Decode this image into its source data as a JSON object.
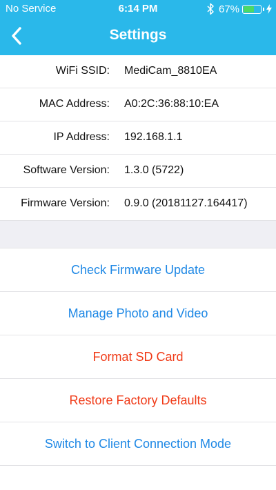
{
  "status_bar": {
    "carrier": "No Service",
    "time": "6:14 PM",
    "battery_percent": "67%",
    "battery_level": 0.67,
    "bluetooth_icon": "bluetooth-icon",
    "charging_icon": "charging-bolt-icon"
  },
  "nav": {
    "title": "Settings",
    "back_icon": "chevron-left-icon"
  },
  "info": [
    {
      "label": "WiFi SSID:",
      "value": "MediCam_8810EA"
    },
    {
      "label": "MAC Address:",
      "value": "A0:2C:36:88:10:EA"
    },
    {
      "label": "IP Address:",
      "value": "192.168.1.1"
    },
    {
      "label": "Software Version:",
      "value": "1.3.0 (5722)"
    },
    {
      "label": "Firmware Version:",
      "value": "0.9.0 (20181127.164417)"
    }
  ],
  "actions": [
    {
      "label": "Check Firmware Update",
      "color": "#1e88e5"
    },
    {
      "label": "Manage Photo and Video",
      "color": "#1e88e5"
    },
    {
      "label": "Format SD Card",
      "color": "#f03a17"
    },
    {
      "label": "Restore Factory Defaults",
      "color": "#f03a17"
    },
    {
      "label": "Switch to Client Connection Mode",
      "color": "#1e88e5"
    }
  ],
  "colors": {
    "header_bg": "#2ab8ea",
    "link_blue": "#1e88e5",
    "destructive_red": "#f03a17",
    "section_bg": "#efeff4"
  }
}
